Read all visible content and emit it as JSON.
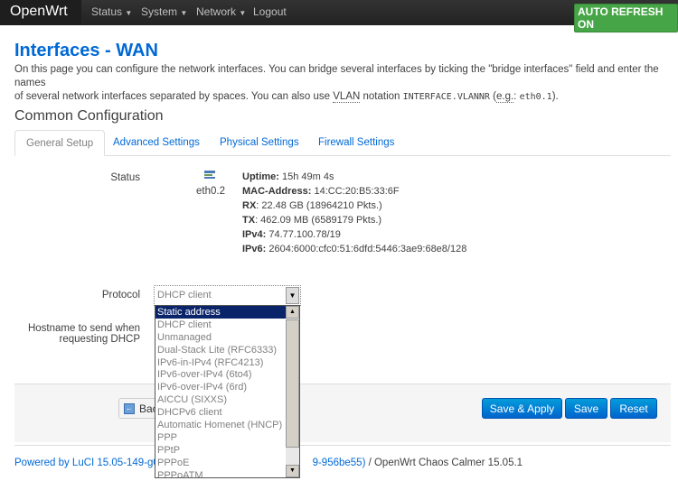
{
  "nav": {
    "brand": "OpenWrt",
    "menus": [
      "Status",
      "System",
      "Network",
      "Logout"
    ],
    "auto_refresh": "AUTO REFRESH ON"
  },
  "page": {
    "title": "Interfaces - WAN",
    "desc1": "On this page you can configure the network interfaces. You can bridge several interfaces by ticking the \"bridge interfaces\" field and enter the names",
    "desc2a": "of several network interfaces separated by spaces. You can also use ",
    "desc2_abbr": "VLAN",
    "desc2b": " notation ",
    "desc2_code": "INTERFACE.VLANNR",
    "desc2c": " (",
    "desc2_eg": "e.g.",
    "desc2d": ": ",
    "desc2_code2": "eth0.1",
    "desc2e": ")."
  },
  "section": {
    "title": "Common Configuration",
    "tabs": [
      "General Setup",
      "Advanced Settings",
      "Physical Settings",
      "Firewall Settings"
    ]
  },
  "status": {
    "label": "Status",
    "iface": "eth0.2",
    "lines": [
      {
        "k": "Uptime:",
        "v": " 15h 49m 4s"
      },
      {
        "k": "MAC-Address:",
        "v": " 14:CC:20:B5:33:6F"
      },
      {
        "k": "RX",
        "v": ": 22.48 GB (18964210 Pkts.)"
      },
      {
        "k": "TX",
        "v": ": 462.09 MB (6589179 Pkts.)"
      },
      {
        "k": "IPv4:",
        "v": " 74.77.100.78/19"
      },
      {
        "k": "IPv6:",
        "v": " 2604:6000:cfc0:51:6dfd:5446:3ae9:68e8/128"
      }
    ]
  },
  "protocol": {
    "label": "Protocol",
    "value": "DHCP client",
    "options": [
      "Static address",
      "DHCP client",
      "Unmanaged",
      "Dual-Stack Lite (RFC6333)",
      "IPv6-in-IPv4 (RFC4213)",
      "IPv6-over-IPv4 (6to4)",
      "IPv6-over-IPv4 (6rd)",
      "AICCU (SIXXS)",
      "DHCPv6 client",
      "Automatic Homenet (HNCP)",
      "PPP",
      "PPtP",
      "PPPoE",
      "PPPoATM"
    ]
  },
  "hostname": {
    "label1": "Hostname to send when",
    "label2": "requesting DHCP"
  },
  "actions": {
    "back": "Bac",
    "save_apply": "Save & Apply",
    "save": "Save",
    "reset": "Reset"
  },
  "footer": {
    "link_start": "Powered by LuCI 15.05-149-g0c",
    "link_end": "9-956be55)",
    "text": " / OpenWrt Chaos Calmer 15.05.1"
  },
  "colors": {
    "accent": "#0069d6",
    "nav_bg": "#222222",
    "auto_refresh": "#46a546",
    "button": "#0064cd"
  }
}
